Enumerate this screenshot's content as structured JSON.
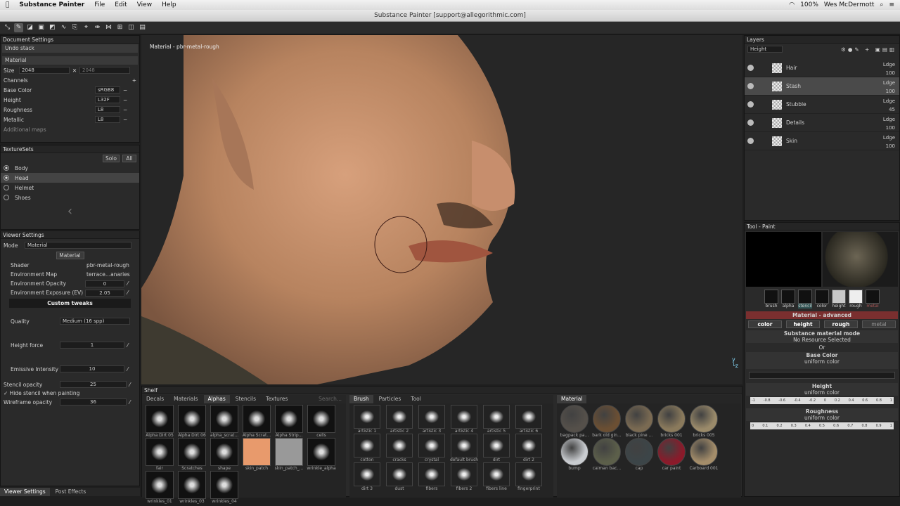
{
  "menubar": {
    "apple": "",
    "app": "Substance Painter",
    "items": [
      "File",
      "Edit",
      "View",
      "Help"
    ],
    "battery": "100%",
    "user": "Wes McDermott"
  },
  "window_title": "Substance Painter [support@allegorithmic.com]",
  "viewport": {
    "label": "Material - pbr-metal-rough",
    "axis_y": "y",
    "axis_z": "z"
  },
  "document_settings": {
    "title": "Document Settings",
    "undo": "Undo stack",
    "material_label": "Material",
    "size_label": "Size",
    "size": "2048",
    "size2": "2048",
    "channels_label": "Channels",
    "channels": [
      {
        "name": "Base Color",
        "format": "sRGB8"
      },
      {
        "name": "Height",
        "format": "L32F"
      },
      {
        "name": "Roughness",
        "format": "L8"
      },
      {
        "name": "Metallic",
        "format": "L8"
      }
    ],
    "additional": "Additional maps"
  },
  "texture_sets": {
    "title": "TextureSets",
    "solo": "Solo",
    "all": "All",
    "items": [
      "Body",
      "Head",
      "Helmet",
      "Shoes"
    ],
    "selected": 1
  },
  "viewer_settings": {
    "title": "Viewer Settings",
    "mode_label": "Mode",
    "mode": "Material",
    "material_btn": "Material",
    "shader_label": "Shader",
    "shader": "pbr-metal-rough",
    "envmap_label": "Environment Map",
    "envmap": "terrace...anaries",
    "envop_label": "Environment Opacity",
    "envop": "0",
    "envexp_label": "Environment Exposure (EV)",
    "envexp": "2.05",
    "custom": "Custom tweaks",
    "quality_label": "Quality",
    "quality": "Medium (16 spp)",
    "heightforce_label": "Height force",
    "heightforce": "1",
    "emissive_label": "Emissive Intensity",
    "emissive": "10",
    "stencil_label": "Stencil opacity",
    "stencil": "25",
    "hide_label": "Hide stencil when painting",
    "wire_label": "Wireframe opacity",
    "wire": "36",
    "bottom_tab1": "Viewer Settings",
    "bottom_tab2": "Post Effects"
  },
  "shelf": {
    "title": "Shelf",
    "tabs": [
      "Decals",
      "Materials",
      "Alphas",
      "Stencils",
      "Textures"
    ],
    "active": 2,
    "search": "Search...",
    "alphas": [
      "Alpha Dirt 05",
      "Alpha Dirt 06",
      "alpha_scrat...",
      "Alpha Scrat...",
      "Alpha Strip...",
      "cells",
      "fair",
      "Scratches",
      "shape",
      "skin_patch",
      "skin_patch_...",
      "wrinkle_alpha",
      "wrinkles_01",
      "wrinkles_03",
      "wrinkles_04"
    ],
    "brush_tabs": [
      "Brush",
      "Particles",
      "Tool"
    ],
    "brushes": [
      "artistic 1",
      "artistic 2",
      "artistic 3",
      "artistic 4",
      "artistic 5",
      "artistic 6",
      "cotton",
      "cracks",
      "crystal",
      "default brush",
      "dirt",
      "dirt 2",
      "dirt 3",
      "dust",
      "fibers",
      "fibers 2",
      "fibers line",
      "fingerprint"
    ],
    "material_tab": "Material",
    "materials": [
      "bagpack pa...",
      "bark old gin...",
      "black pine ...",
      "bricks 001",
      "bricks 005",
      "bump",
      "caiman bac...",
      "cap",
      "car paint",
      "Carboard 001"
    ]
  },
  "layers": {
    "title": "Layers",
    "channel": "Height",
    "items": [
      {
        "name": "Hair",
        "blend": "Ldge",
        "value": "100"
      },
      {
        "name": "Stash",
        "blend": "Ldge",
        "value": "100"
      },
      {
        "name": "Stubble",
        "blend": "Ldge",
        "value": "45"
      },
      {
        "name": "Details",
        "blend": "Ldge",
        "value": "100"
      },
      {
        "name": "Skin",
        "blend": "Ldge",
        "value": "100"
      }
    ]
  },
  "tool": {
    "title": "Tool - Paint",
    "slots": [
      "brush",
      "alpha",
      "stencil",
      "color",
      "height",
      "rough",
      "metal"
    ],
    "mat_adv": "Material - advanced",
    "chans": [
      "color",
      "height",
      "rough",
      "metal"
    ],
    "mode_title": "Substance material mode",
    "no_res": "No Resource Selected",
    "or": "Or",
    "base_color": "Base Color",
    "uniform": "uniform color",
    "height_lbl": "Height",
    "rough_lbl": "Roughness",
    "slider_ticks": [
      "-1",
      "-0.8",
      "-0.6",
      "-0.4",
      "-0.2",
      "0",
      "0.2",
      "0.4",
      "0.6",
      "0.8",
      "1"
    ],
    "rough_ticks": [
      "0",
      "0.1",
      "0.2",
      "0.3",
      "0.4",
      "0.5",
      "0.6",
      "0.7",
      "0.8",
      "0.9",
      "1"
    ]
  }
}
